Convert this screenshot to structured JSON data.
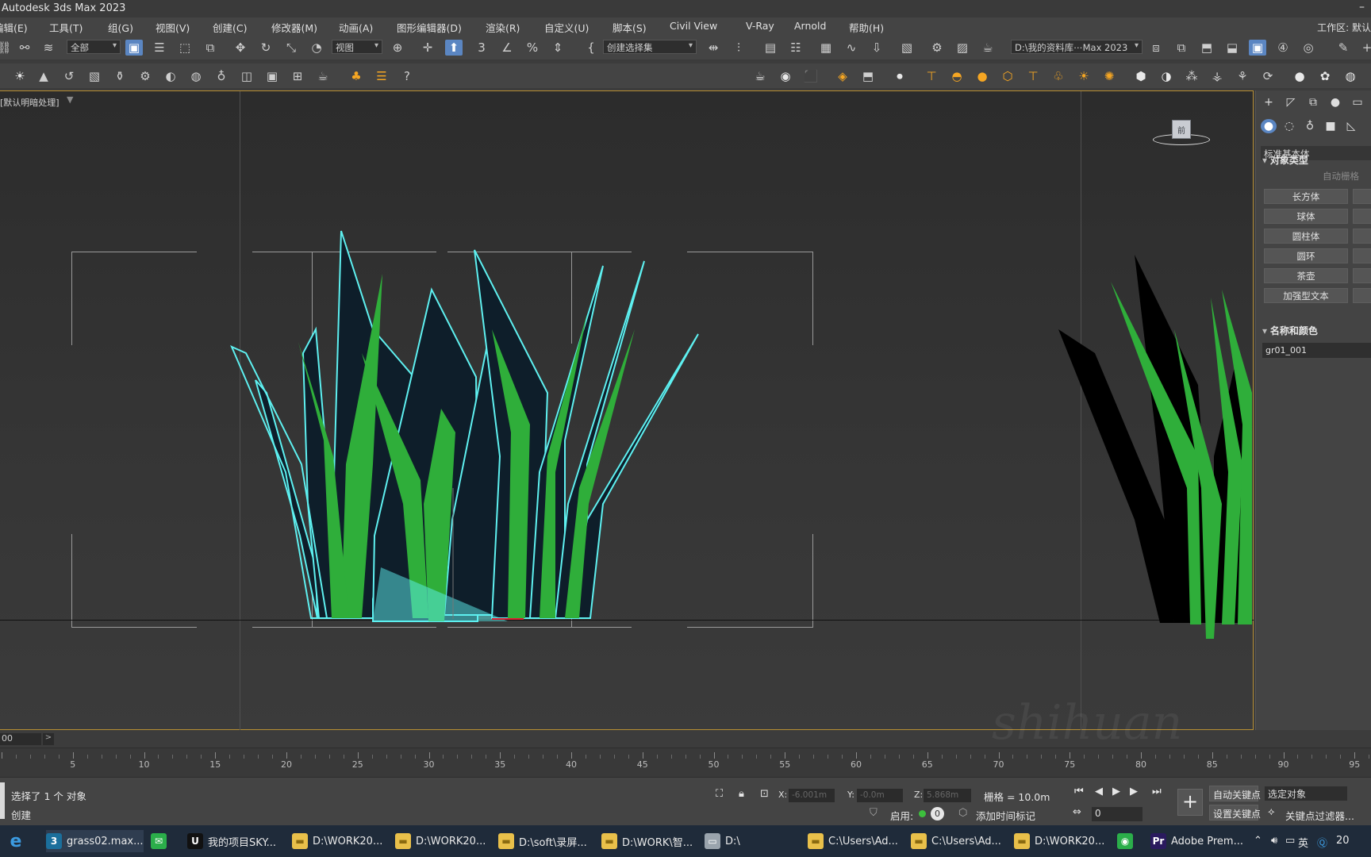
{
  "window": {
    "title": "Autodesk 3ds Max 2023"
  },
  "menu": {
    "items": [
      "编辑(E)",
      "工具(T)",
      "组(G)",
      "视图(V)",
      "创建(C)",
      "修改器(M)",
      "动画(A)",
      "图形编辑器(D)",
      "渲染(R)",
      "自定义(U)",
      "脚本(S)",
      "Civil View",
      "V-Ray",
      "Arnold",
      "帮助(H)"
    ],
    "workspace": "工作区: 默认"
  },
  "toolbar": {
    "selection_filter": "全部",
    "ref_coord": "视图",
    "named_selection": "创建选择集",
    "project_path": "D:\\我的资料库⋯Max 2023"
  },
  "viewport": {
    "label": "[默认明暗处理]",
    "viewcube_label": "前"
  },
  "command_panel": {
    "category": "标准基本体",
    "rollout_object_type": "对象类型",
    "auto_grid": "自动栅格",
    "buttons": [
      "长方体",
      "球体",
      "圆柱体",
      "圆环",
      "茶壶",
      "加强型文本"
    ],
    "rollout_name_color": "名称和颜色",
    "object_name": "gr01_001"
  },
  "timeline": {
    "current_frame": "00",
    "tick_labels": [
      "5",
      "10",
      "15",
      "20",
      "25",
      "30",
      "35",
      "40",
      "45",
      "50",
      "55",
      "60",
      "65",
      "70",
      "75",
      "80",
      "85",
      "90",
      "95"
    ]
  },
  "status": {
    "selection": "选择了 1 个 对象",
    "prompt": "创建",
    "x_label": "X:",
    "x_value": "-6.001m",
    "y_label": "Y:",
    "y_value": "-0.0m",
    "z_label": "Z:",
    "z_value": "5.868m",
    "grid": "栅格 = 10.0m",
    "enabled_label": "启用:",
    "enabled_count": "0",
    "add_time_tag": "添加时间标记",
    "auto_key": "自动关键点",
    "set_key": "设置关键点",
    "key_mode": "选定对象",
    "key_filters": "关键点过滤器...",
    "frame_spinner": "0"
  },
  "taskbar": {
    "items": [
      {
        "label": "grass02.max...",
        "icon": "3ds",
        "color": "#1b6f9c"
      },
      {
        "label": "",
        "icon": "wechat",
        "color": "#2bae4a"
      },
      {
        "label": "我的项目SKY...",
        "icon": "unreal",
        "color": "#111111"
      },
      {
        "label": "D:\\WORK20...",
        "icon": "folder",
        "color": "#e9c04a"
      },
      {
        "label": "D:\\WORK20...",
        "icon": "folder",
        "color": "#e9c04a"
      },
      {
        "label": "D:\\soft\\录屏...",
        "icon": "folder",
        "color": "#e9c04a"
      },
      {
        "label": "D:\\WORK\\智...",
        "icon": "folder",
        "color": "#e9c04a"
      },
      {
        "label": "D:\\",
        "icon": "drive",
        "color": "#9aa4ad"
      },
      {
        "label": "C:\\Users\\Ad...",
        "icon": "folder",
        "color": "#e9c04a"
      },
      {
        "label": "C:\\Users\\Ad...",
        "icon": "folder",
        "color": "#e9c04a"
      },
      {
        "label": "D:\\WORK20...",
        "icon": "folder",
        "color": "#e9c04a"
      },
      {
        "label": "",
        "icon": "chrome",
        "color": "#2bae4a"
      },
      {
        "label": "Adobe Prem...",
        "icon": "premiere",
        "color": "#2a1a5e"
      }
    ],
    "tray_lang": "英",
    "clock": "20"
  },
  "watermark": "shihuan",
  "colors": {
    "selection": "#5ef0f0",
    "grass": "#2fae3a",
    "accent": "#5b86c2",
    "frame": "#b88f33"
  }
}
